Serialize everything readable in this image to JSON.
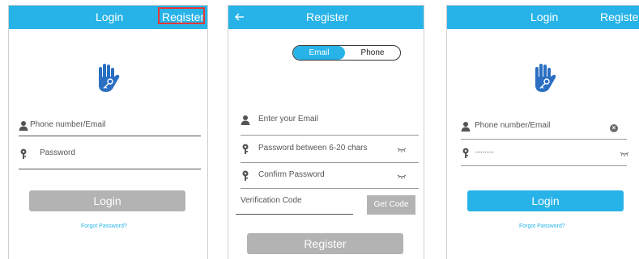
{
  "screen1": {
    "title": "Login",
    "register_link": "Register",
    "phone_placeholder": "Phone number/Email",
    "password_placeholder": "Password",
    "login_button": "Login",
    "forgot_password": "Forgot Password?"
  },
  "screen2": {
    "title": "Register",
    "toggle": {
      "email": "Email",
      "phone": "Phone",
      "active": "Email"
    },
    "email_placeholder": "Enter your Email",
    "password_placeholder": "Password between 6-20 chars",
    "confirm_placeholder": "Confirm Password",
    "verification_placeholder": "Verification Code",
    "get_code_button": "Get Code",
    "register_button": "Register"
  },
  "screen3": {
    "title": "Login",
    "register_link": "Registe",
    "phone_placeholder": "Phone number/Email",
    "password_value": "··········",
    "login_button": "Login",
    "forgot_password": "Forgot Password?"
  },
  "colors": {
    "accent": "#27b3e8",
    "highlight": "#e53935",
    "disabled_button": "#b3b3b3",
    "hand_icon": "#2a6fc2"
  },
  "icons": [
    "arrow-left-icon",
    "hand-key-icon",
    "user-icon",
    "key-icon",
    "eye-closed-icon",
    "clear-icon"
  ]
}
